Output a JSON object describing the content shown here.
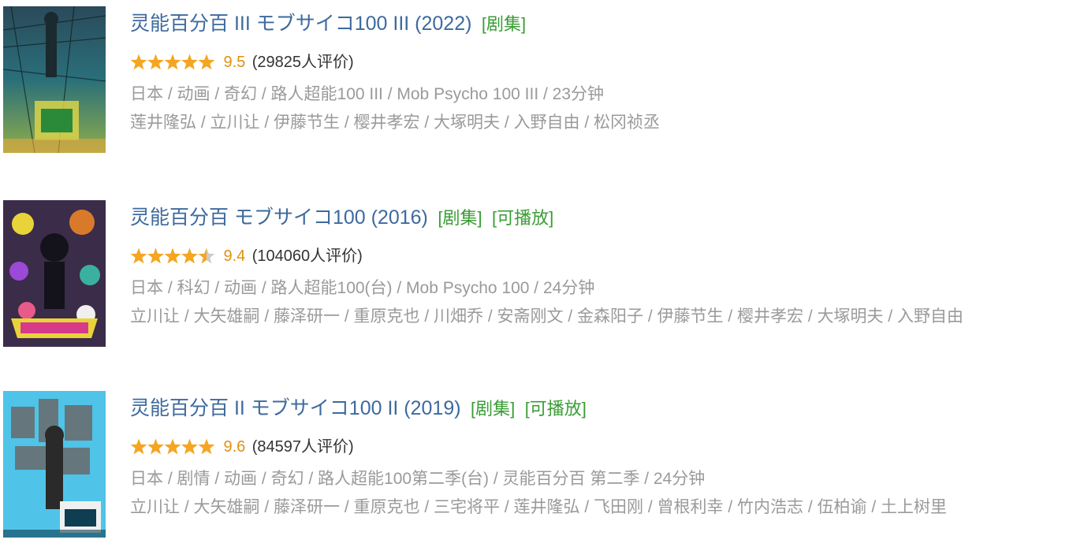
{
  "items": [
    {
      "title": "灵能百分百 III モブサイコ100 III (2022)",
      "tags": [
        "[剧集]"
      ],
      "rating": {
        "stars": 5,
        "score": "9.5",
        "count": "(29825人评价)"
      },
      "meta": "日本 / 动画 / 奇幻 / 路人超能100 III / Mob Psycho 100 III / 23分钟",
      "cast": "莲井隆弘 / 立川让 / 伊藤节生 / 樱井孝宏 / 大塚明夫 / 入野自由 / 松冈祯丞",
      "poster_colors": {
        "base": "#2a6f7a",
        "accent": "#d9d24a",
        "dark": "#1a2a2e"
      }
    },
    {
      "title": "灵能百分百 モブサイコ100 (2016)",
      "tags": [
        "[剧集]",
        "[可播放]"
      ],
      "rating": {
        "stars": 4.5,
        "score": "9.4",
        "count": "(104060人评价)"
      },
      "meta": "日本 / 科幻 / 动画 / 路人超能100(台) / Mob Psycho 100 / 24分钟",
      "cast": "立川让 / 大矢雄嗣 / 藤泽研一 / 重原克也 / 川畑乔 / 安斋刚文 / 金森阳子 / 伊藤节生 / 樱井孝宏 / 大塚明夫 / 入野自由",
      "poster_colors": {
        "base": "#3b2c4a",
        "accent": "#e8d43a",
        "dark": "#14121a"
      }
    },
    {
      "title": "灵能百分百 II モブサイコ100 II (2019)",
      "tags": [
        "[剧集]",
        "[可播放]"
      ],
      "rating": {
        "stars": 5,
        "score": "9.6",
        "count": "(84597人评价)"
      },
      "meta": "日本 / 剧情 / 动画 / 奇幻 / 路人超能100第二季(台) / 灵能百分百 第二季 / 24分钟",
      "cast": "立川让 / 大矢雄嗣 / 藤泽研一 / 重原克也 / 三宅将平 / 莲井隆弘 / 飞田刚 / 曾根利幸 / 竹内浩志 / 伍柏谕 / 土上树里",
      "poster_colors": {
        "base": "#4fc4e8",
        "accent": "#2a2a2a",
        "dark": "#0f3d52"
      }
    }
  ],
  "colors": {
    "star": "#f4a623",
    "star_empty": "#cccccc",
    "title": "#3d6a9e",
    "tag": "#3a9d35",
    "meta": "#9a9a9a"
  }
}
